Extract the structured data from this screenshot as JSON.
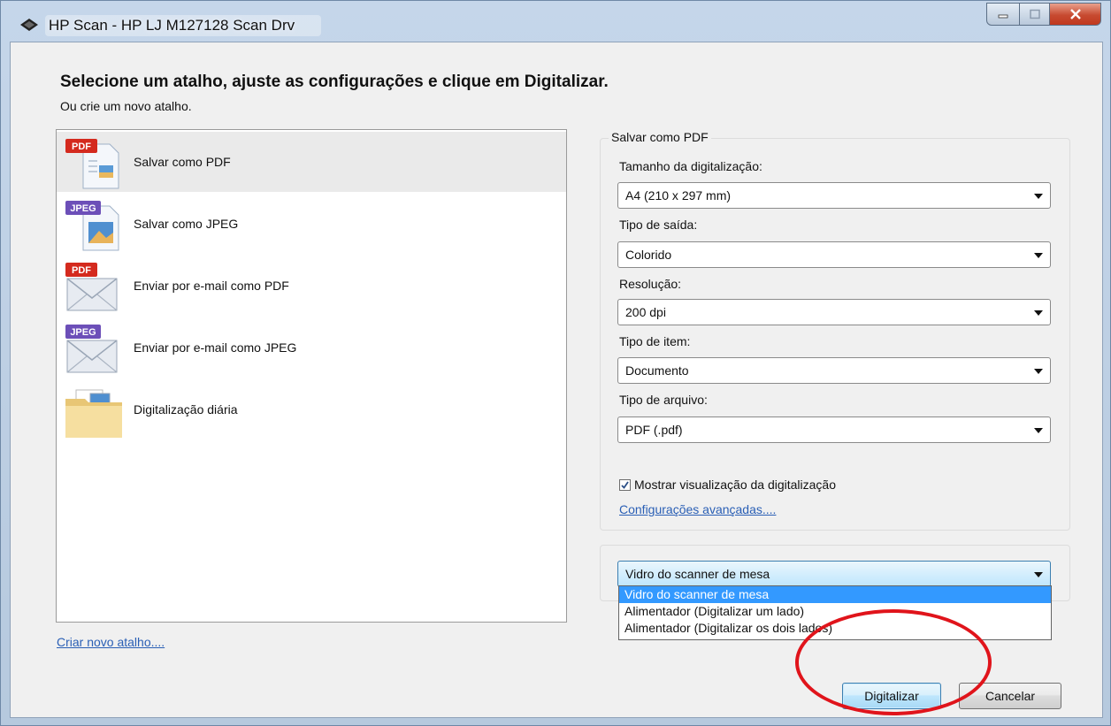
{
  "window": {
    "title": "HP Scan - HP LJ M127128 Scan Drv"
  },
  "header": {
    "heading": "Selecione um atalho, ajuste as configurações e clique em Digitalizar.",
    "subheading": "Ou crie um novo atalho."
  },
  "shortcuts": {
    "items": [
      {
        "label": "Salvar como PDF",
        "badge": "PDF",
        "icon": "pdf-document-icon"
      },
      {
        "label": "Salvar como JPEG",
        "badge": "JPEG",
        "icon": "jpeg-document-icon"
      },
      {
        "label": "Enviar por e-mail como PDF",
        "badge": "PDF",
        "icon": "pdf-email-icon"
      },
      {
        "label": "Enviar por e-mail como JPEG",
        "badge": "JPEG",
        "icon": "jpeg-email-icon"
      },
      {
        "label": "Digitalização diária",
        "icon": "folder-icon"
      }
    ],
    "selected_index": 0,
    "create_link": "Criar novo atalho...."
  },
  "settings": {
    "group_title": "Salvar como PDF",
    "scan_size_label": "Tamanho da digitalização:",
    "scan_size_value": "A4 (210 x 297 mm)",
    "output_type_label": "Tipo de saída:",
    "output_type_value": "Colorido",
    "resolution_label": "Resolução:",
    "resolution_value": "200 dpi",
    "item_type_label": "Tipo de item:",
    "item_type_value": "Documento",
    "file_type_label": "Tipo de arquivo:",
    "file_type_value": "PDF (.pdf)",
    "show_preview_label": "Mostrar visualização da digitalização",
    "show_preview_checked": true,
    "advanced_link": "Configurações avançadas...."
  },
  "source": {
    "value": "Vidro do scanner de mesa",
    "options": [
      "Vidro do scanner de mesa",
      "Alimentador (Digitalizar um lado)",
      "Alimentador (Digitalizar os dois lados)"
    ],
    "highlighted_index": 0
  },
  "buttons": {
    "scan": "Digitalizar",
    "cancel": "Cancelar"
  },
  "colors": {
    "pdf_badge": "#d42a1e",
    "jpeg_badge": "#6c4fb8",
    "link": "#2a5fb5",
    "highlight": "#3399ff",
    "annotation_circle": "#e0141b"
  }
}
